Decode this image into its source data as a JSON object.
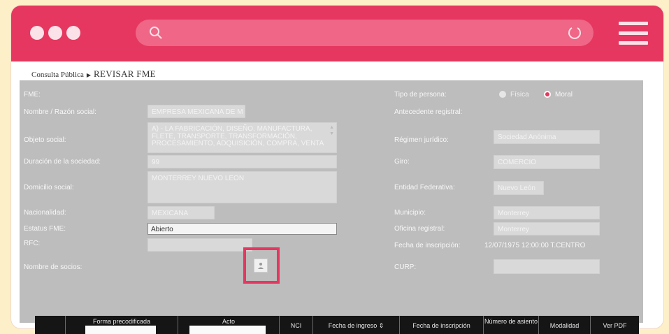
{
  "browser": {
    "colors": {
      "brand": "#e5375f",
      "address_bar": "#ef6686",
      "page_bg": "#fdf0c8"
    },
    "icons": [
      "search-icon",
      "reload-icon",
      "hamburger-menu-icon"
    ]
  },
  "breadcrumb": {
    "root": "Consulta Pública",
    "current": "REVISAR FME"
  },
  "form": {
    "fme_label": "FME:",
    "nombre_label": "Nombre / Razón social:",
    "nombre_value": "EMPRESA MEXICANA DE M",
    "objeto_label": "Objeto social:",
    "objeto_value": "A) - LA FABRICACIÓN, DISEÑO, MANUFACTURA, FLETE, TRANSPORTE, TRANSFORMACIÓN, PROCESAMIENTO, ADQUISICIÓN, COMPRA, VENTA",
    "duracion_label": "Duración de la sociedad:",
    "duracion_value": "99",
    "domicilio_label": "Domicilio social:",
    "domicilio_value": "MONTERREY NUEVO LEON",
    "nacionalidad_label": "Nacionalidad:",
    "nacionalidad_value": "MEXICANA",
    "estatus_label": "Estatus FME:",
    "estatus_value": "Abierto",
    "rfc_label": "RFC:",
    "rfc_value": "",
    "socios_label": "Nombre de socios:",
    "tipo_label": "Tipo de persona:",
    "tipo_fisica": "Física",
    "tipo_moral": "Moral",
    "antecedente_label": "Antecedente registral:",
    "regimen_label": "Régimen jurídico:",
    "regimen_value": "Sociedad Anónima",
    "giro_label": "Giro:",
    "giro_value": "COMERCIO",
    "entidad_label": "Entidad Federativa:",
    "entidad_value": "Nuevo León",
    "municipio_label": "Municipio:",
    "municipio_value": "Monterrey",
    "oficina_label": "Oficina registral:",
    "oficina_value": "Monterrey",
    "fecha_insc_label": "Fecha de inscripción:",
    "fecha_insc_value": "12/07/1975 12:00:00 T.CENTRO",
    "curp_label": "CURP:",
    "curp_value": ""
  },
  "table": {
    "headers": [
      "Forma precodificada",
      "Acto",
      "NCI",
      "Fecha de ingreso ⇕",
      "Fecha de inscripción",
      "Número de asiento",
      "Modalidad",
      "Ver PDF"
    ]
  }
}
